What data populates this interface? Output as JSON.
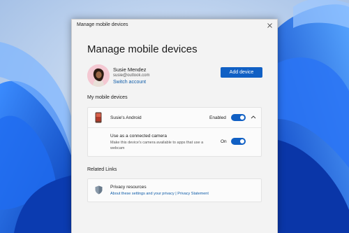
{
  "window": {
    "title": "Manage mobile devices",
    "close_icon": "close-icon"
  },
  "header": {
    "title": "Manage mobile devices"
  },
  "account": {
    "name": "Susie Mendez",
    "email": "susie@outlook.com",
    "switch_label": "Switch account",
    "avatar_icon": "avatar"
  },
  "add_device": {
    "label": "Add device",
    "color": "#1160c4"
  },
  "devices_section": {
    "heading": "My mobile devices",
    "devices": [
      {
        "name": "Susie's Android",
        "icon": "phone-icon",
        "status_label": "Enabled",
        "enabled": true,
        "expanded": true,
        "settings": [
          {
            "title": "Use as a connected camera",
            "description": "Make this device's camera available to apps that use a webcam",
            "state_label": "On",
            "on": true
          }
        ]
      }
    ]
  },
  "related": {
    "heading": "Related Links",
    "item": {
      "icon": "shield-icon",
      "title": "Privacy resources",
      "link1": "About these settings and your privacy",
      "separator": "|",
      "link2": "Privacy Statement"
    }
  },
  "colors": {
    "accent": "#1160c4",
    "link": "#0f5ca8"
  }
}
